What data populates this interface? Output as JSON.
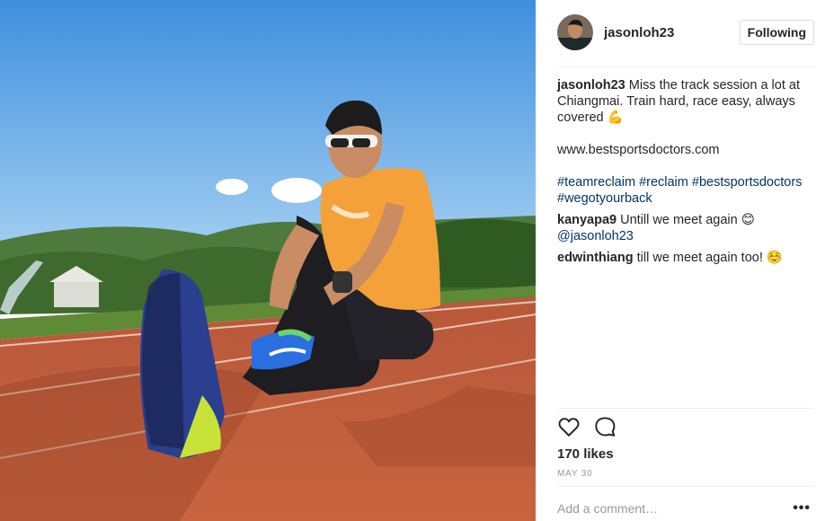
{
  "post": {
    "username": "jasonloh23",
    "follow_button": "Following",
    "caption": {
      "author": "jasonloh23",
      "text": "Miss the track session a lot at Chiangmai. Train hard, race easy, always covered",
      "emoji": "💪",
      "link": "www.bestsportsdoctors.com",
      "hashtags": [
        "#teamreclaim",
        "#reclaim",
        "#bestsportsdoctors",
        "#wegotyourback"
      ]
    },
    "comments": [
      {
        "author": "kanyapa9",
        "text": "Untill we meet again",
        "emoji": "😊",
        "mention": "@jasonloh23"
      },
      {
        "author": "edwinthiang",
        "text": "till we meet again too!",
        "emoji": "☺️"
      }
    ],
    "likes": "170 likes",
    "date": "MAY 30",
    "add_comment_placeholder": "Add a comment…",
    "more_options": "•••",
    "icons": {
      "like": "heart-icon",
      "comment": "comment-bubble-icon",
      "more": "more-options-icon"
    },
    "colors": {
      "hashtag": "#003569",
      "text": "#262626",
      "muted": "#999999",
      "border": "#efefef"
    }
  }
}
